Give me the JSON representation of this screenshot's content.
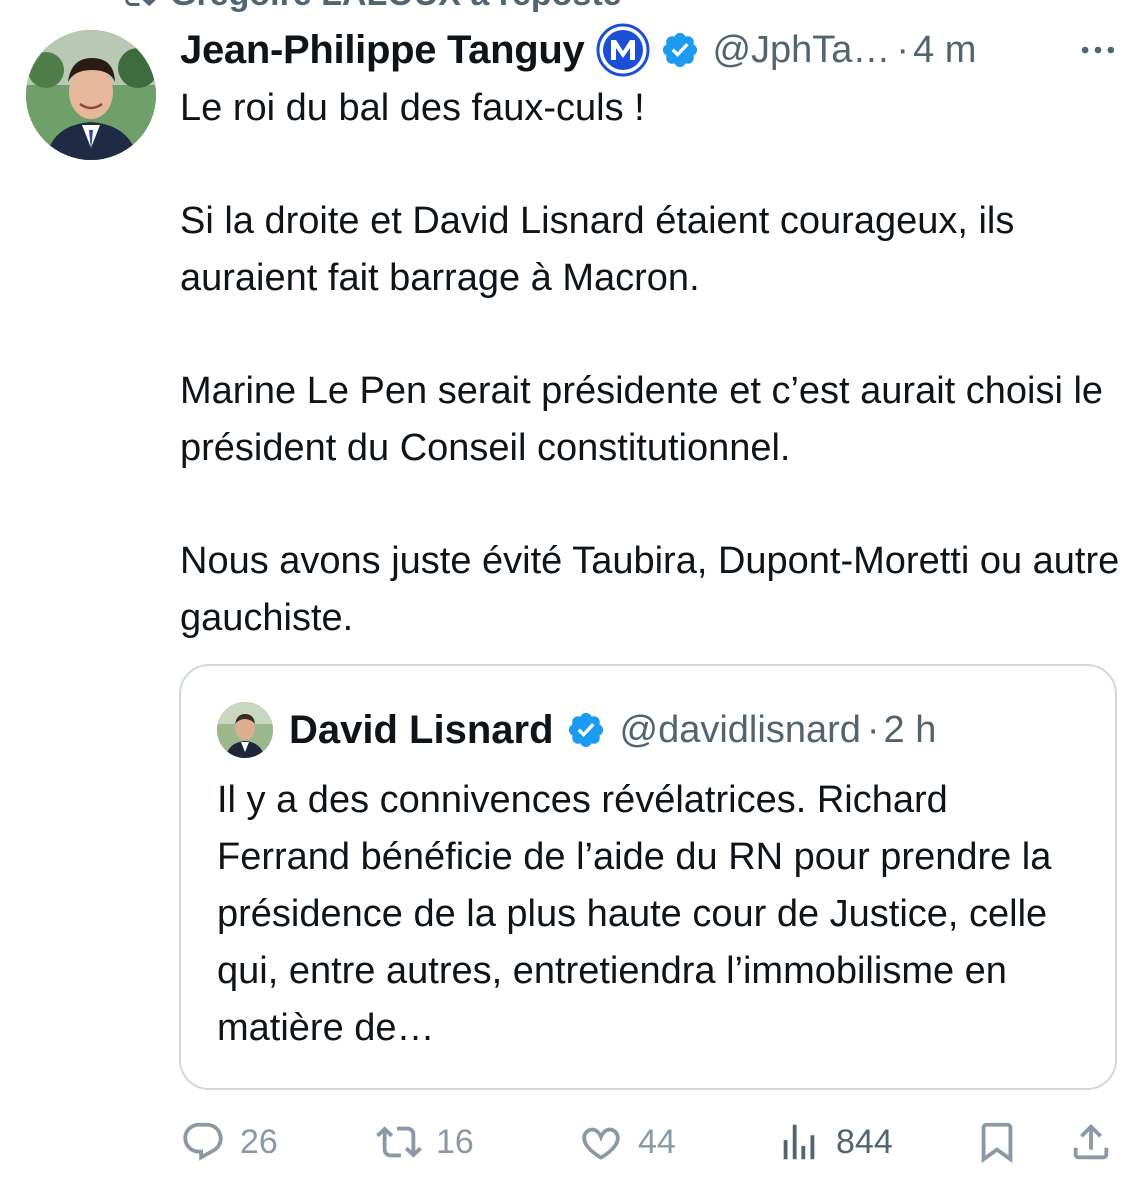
{
  "repost_banner": {
    "text": "Grégoire LALOUX a reposté"
  },
  "tweet": {
    "author_name": "Jean-Philippe Tanguy",
    "author_handle": "@JphTa…",
    "separator": "·",
    "time": "4 m",
    "paragraphs": [
      "Le roi du bal des faux-culs !",
      "Si la droite et David Lisnard étaient courageux, ils auraient fait barrage à Macron.",
      "Marine Le Pen serait présidente et c’est aurait choisi le président du Conseil constitutionnel.",
      "Nous avons juste évité Taubira, Dupont-Moretti ou autre gauchiste."
    ]
  },
  "quote": {
    "author_name": "David Lisnard",
    "author_handle": "@davidlisnard",
    "separator": "·",
    "time": "2 h",
    "text": "Il y a des connivences révélatrices.  Richard Ferrand bénéficie de l’aide du RN pour prendre la présidence de la plus haute cour de Justice, celle qui, entre autres, entretiendra l’immobilisme en matière de…"
  },
  "actions": {
    "replies": "26",
    "reposts": "16",
    "likes": "44",
    "views": "844"
  },
  "colors": {
    "text_primary": "#0f1419",
    "text_secondary": "#536471",
    "action_muted": "#8b98a5",
    "verified_blue": "#1d9bf0",
    "m_badge_blue": "#1a4fd6",
    "quote_border": "#cfd9de"
  },
  "icons": {
    "repost_banner": "repost-icon",
    "affiliation": "m-affiliation-badge-icon",
    "verified": "verified-badge-icon",
    "more": "more-options-icon",
    "reply": "reply-icon",
    "repost": "repost-icon",
    "like": "heart-icon",
    "views": "views-chart-icon",
    "bookmark": "bookmark-icon",
    "share": "share-icon"
  }
}
